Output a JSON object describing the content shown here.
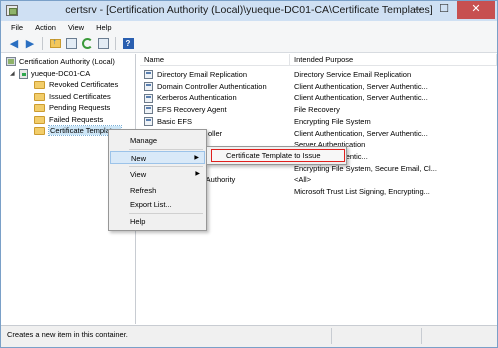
{
  "window": {
    "title": "certsrv - [Certification Authority (Local)\\yueque-DC01-CA\\Certificate Templates]",
    "controls": [
      "–",
      "☐",
      "✕"
    ]
  },
  "menubar": [
    "File",
    "Action",
    "View",
    "Help"
  ],
  "toolbar": [
    "back-icon",
    "forward-icon",
    "up-folder-icon",
    "properties-icon",
    "refresh-icon",
    "export-icon",
    "help-icon"
  ],
  "tree": {
    "root": "Certification Authority (Local)",
    "ca": "yueque-DC01-CA",
    "folders": [
      "Revoked Certificates",
      "Issued Certificates",
      "Pending Requests",
      "Failed Requests",
      "Certificate Templates"
    ],
    "selected": "Certificate Templates"
  },
  "list": {
    "columns": [
      "Name",
      "Intended Purpose"
    ],
    "rows": [
      {
        "name": "Directory Email Replication",
        "purpose": "Directory Service Email Replication"
      },
      {
        "name": "Domain Controller Authentication",
        "purpose": "Client Authentication, Server Authentic..."
      },
      {
        "name": "Kerberos Authentication",
        "purpose": "Client Authentication, Server Authentic..."
      },
      {
        "name": "EFS Recovery Agent",
        "purpose": "File Recovery"
      },
      {
        "name": "Basic EFS",
        "purpose": "Encrypting File System"
      },
      {
        "name": "oller",
        "purpose": "Client Authentication, Server Authentic..."
      },
      {
        "name": "",
        "purpose": "Server Authentication"
      },
      {
        "name": "",
        "purpose": "on, Server Authentic..."
      },
      {
        "name": "",
        "purpose": "Encrypting File System, Secure Email, Cl..."
      },
      {
        "name": "rtification Authority",
        "purpose": "<All>"
      },
      {
        "name": "",
        "purpose": "Microsoft Trust List Signing, Encrypting..."
      }
    ]
  },
  "context_menu": {
    "items": [
      {
        "label": "Manage",
        "submenu": false
      },
      {
        "label": "New",
        "submenu": true
      },
      {
        "label": "View",
        "submenu": true
      },
      {
        "label": "Refresh",
        "submenu": false
      },
      {
        "label": "Export List...",
        "submenu": false
      },
      {
        "label": "Help",
        "submenu": false
      }
    ],
    "submenu_arrow": "▶",
    "new_submenu": "Certificate Template to Issue"
  },
  "status": "Creates a new item in this container.",
  "colors": {
    "highlight": "#e0201d",
    "selection": "#cde6f7",
    "close_button": "#c75050"
  }
}
